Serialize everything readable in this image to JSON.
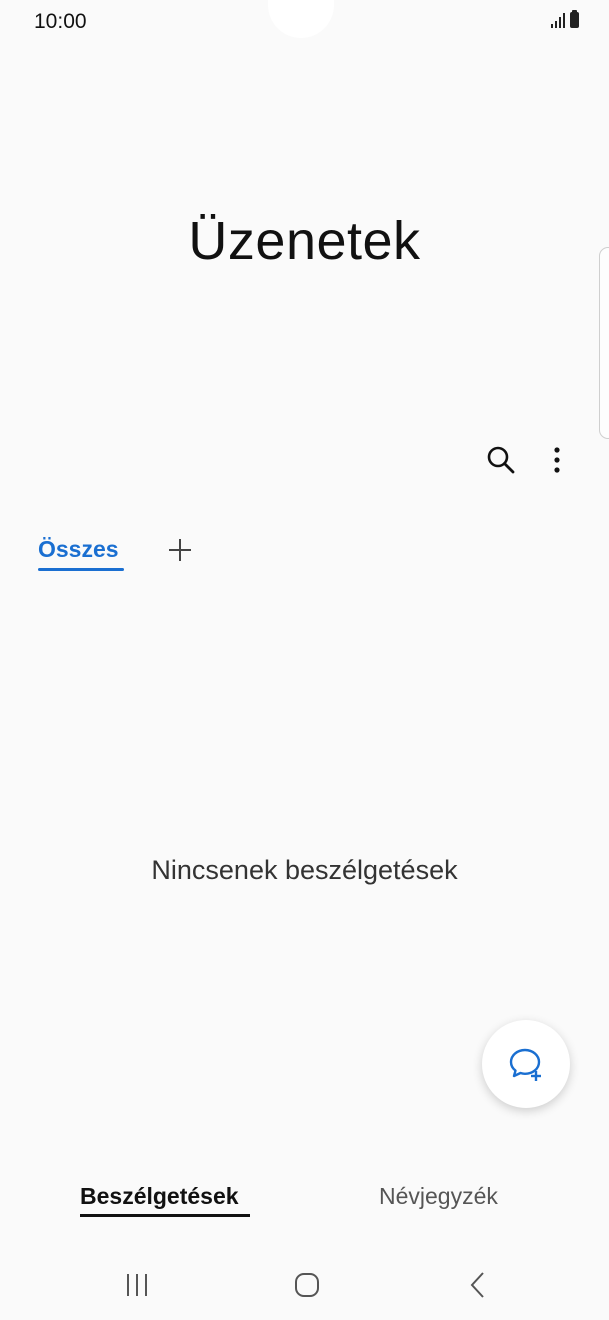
{
  "status_bar": {
    "time": "10:00"
  },
  "app": {
    "title": "Üzenetek"
  },
  "toolbar": {
    "search_icon": "search-icon",
    "more_icon": "more-vertical-icon"
  },
  "category_tabs": {
    "active_tab": "Összes",
    "add_icon": "plus-icon"
  },
  "main": {
    "empty_message": "Nincsenek beszélgetések"
  },
  "fab": {
    "icon": "new-message-icon",
    "color": "#1a6fd1"
  },
  "bottom_tabs": {
    "items": [
      {
        "label": "Beszélgetések",
        "active": true
      },
      {
        "label": "Névjegyzék",
        "active": false
      }
    ]
  },
  "navigation_bar": {
    "icons": [
      "recents-icon",
      "home-icon",
      "back-icon"
    ]
  },
  "colors": {
    "accent": "#1a6fd1",
    "background": "#fafafa"
  }
}
